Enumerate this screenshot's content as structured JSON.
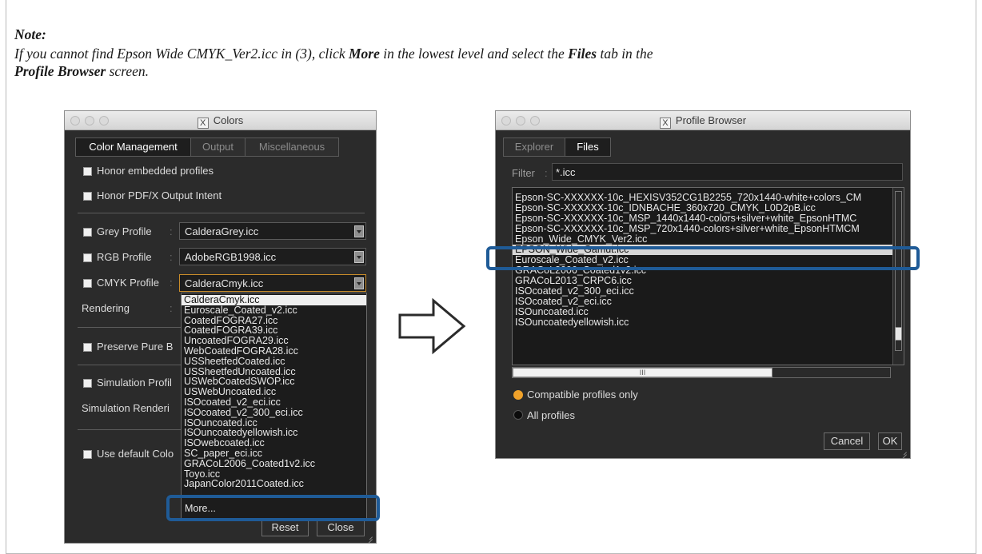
{
  "note": {
    "title": "Note:",
    "line1_a": "If you cannot find Epson Wide CMYK_Ver2.icc in (3), click ",
    "line1_more": "More",
    "line1_b": " in the lowest level and select the ",
    "line1_files": "Files",
    "line1_c": " tab in the",
    "line2_pb": "Profile Browser",
    "line2_b": " screen."
  },
  "colors_window": {
    "title": "Colors",
    "tabs": [
      "Color Management",
      "Output",
      "Miscellaneous"
    ],
    "honor_embedded": "Honor embedded profiles",
    "honor_pdfx": "Honor PDF/X Output Intent",
    "grey_profile_label": "Grey Profile",
    "grey_profile_value": "CalderaGrey.icc",
    "rgb_profile_label": "RGB Profile",
    "rgb_profile_value": "AdobeRGB1998.icc",
    "cmyk_profile_label": "CMYK Profile",
    "cmyk_profile_value": "CalderaCmyk.icc",
    "rendering_label": "Rendering",
    "preserve_label": "Preserve Pure B",
    "simulation_profile_label": "Simulation Profil",
    "simulation_rendering_label": "Simulation Renderi",
    "use_default_label": "Use default Colo",
    "colon": ":",
    "checkmark": "✔",
    "dropdown_items": [
      "CalderaCmyk.icc",
      "Euroscale_Coated_v2.icc",
      "CoatedFOGRA27.icc",
      "CoatedFOGRA39.icc",
      "UncoatedFOGRA29.icc",
      "WebCoatedFOGRA28.icc",
      "USSheetfedCoated.icc",
      "USSheetfedUncoated.icc",
      "USWebCoatedSWOP.icc",
      "USWebUncoated.icc",
      "ISOcoated_v2_eci.icc",
      "ISOcoated_v2_300_eci.icc",
      "ISOuncoated.icc",
      "ISOuncoatedyellowish.icc",
      "ISOwebcoated.icc",
      "SC_paper_eci.icc",
      "GRACoL2006_Coated1v2.icc",
      "Toyo.icc",
      "JapanColor2011Coated.icc"
    ],
    "more_label": "More...",
    "reset_label": "Reset",
    "close_label": "Close"
  },
  "arrow": {
    "icon": "right-arrow-icon"
  },
  "profile_browser": {
    "title": "Profile Browser",
    "tabs": [
      "Explorer",
      "Files"
    ],
    "filter_label": "Filter",
    "filter_colon": ":",
    "filter_value": "*.icc",
    "list": [
      "Epson-SC-XXXXXX-10c_HEXISV352CG1B2255_720x1440-white+colors_CM",
      "Epson-SC-XXXXXX-10c_IDNBACHE_360x720_CMYK_L0D2pB.icc",
      "Epson-SC-XXXXXX-10c_MSP_1440x1440-colors+silver+white_EpsonHTMC",
      "Epson-SC-XXXXXX-10c_MSP_720x1440-colors+silver+white_EpsonHTMCM",
      "Epson_Wide_CMYK_Ver2.icc",
      "EPSON_Wide_Gamut.icc",
      "Euroscale_Coated_v2.icc",
      "GRACoL2006_Coated1v2.icc",
      "GRACoL2013_CRPC6.icc",
      "ISOcoated_v2_300_eci.icc",
      "ISOcoated_v2_eci.icc",
      "ISOuncoated.icc",
      "ISOuncoatedyellowish.icc"
    ],
    "hscroll_label": "III",
    "radio_compatible": "Compatible profiles only",
    "radio_all": "All profiles",
    "cancel_label": "Cancel",
    "ok_label": "OK"
  },
  "colors": {
    "highlight": "#1f5b97",
    "radio_selected": "#f0a22a",
    "window_bg": "#2b2b2b"
  }
}
